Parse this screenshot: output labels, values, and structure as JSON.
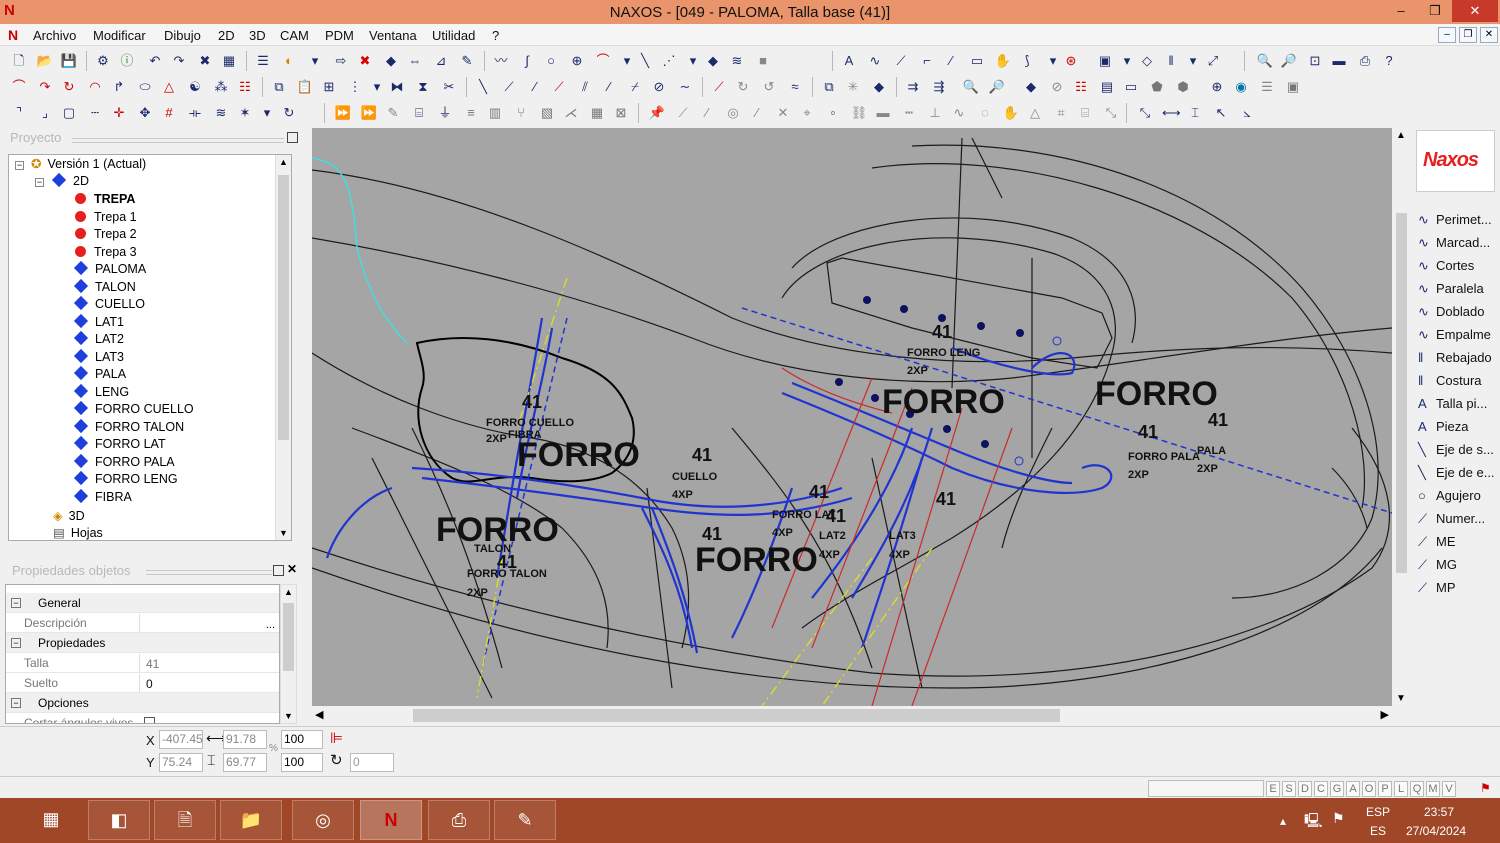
{
  "window": {
    "title": "NAXOS - [049 - PALOMA, Talla base (41)]",
    "min": "–",
    "max": "❐",
    "close": "✕"
  },
  "menu": [
    "Archivo",
    "Modificar",
    "Dibujo",
    "2D",
    "3D",
    "CAM",
    "PDM",
    "Ventana",
    "Utilidad",
    "?"
  ],
  "project": {
    "header": "Proyecto",
    "nodes": [
      {
        "label": "Versión 1 (Actual)",
        "type": "version"
      },
      {
        "label": "2D",
        "type": "folder"
      },
      {
        "label": "TREPA",
        "type": "red",
        "bold": true
      },
      {
        "label": "Trepa 1",
        "type": "red"
      },
      {
        "label": "Trepa 2",
        "type": "red"
      },
      {
        "label": "Trepa 3",
        "type": "red"
      },
      {
        "label": "PALOMA",
        "type": "piece"
      },
      {
        "label": "TALON",
        "type": "piece"
      },
      {
        "label": "CUELLO",
        "type": "piece"
      },
      {
        "label": "LAT1",
        "type": "piece"
      },
      {
        "label": "LAT2",
        "type": "piece"
      },
      {
        "label": "LAT3",
        "type": "piece"
      },
      {
        "label": "PALA",
        "type": "piece"
      },
      {
        "label": "LENG",
        "type": "piece"
      },
      {
        "label": "FORRO CUELLO",
        "type": "piece"
      },
      {
        "label": "FORRO TALON",
        "type": "piece"
      },
      {
        "label": "FORRO LAT",
        "type": "piece"
      },
      {
        "label": "FORRO PALA",
        "type": "piece"
      },
      {
        "label": "FORRO LENG",
        "type": "piece"
      },
      {
        "label": "FIBRA",
        "type": "piece"
      },
      {
        "label": "3D",
        "type": "folder3d"
      },
      {
        "label": "Hojas",
        "type": "sheets"
      }
    ]
  },
  "properties": {
    "header": "Propiedades objetos",
    "sec_general": "General",
    "descripcion_label": "Descripción",
    "descripcion_btn": "...",
    "sec_props": "Propiedades",
    "talla_label": "Talla",
    "talla": "41",
    "suelto_label": "Suelto",
    "suelto": "0",
    "sec_opciones": "Opciones",
    "cortar_label": "Cortar ángulos vivos"
  },
  "right_tools": [
    "Perimet...",
    "Marcad...",
    "Cortes",
    "Paralela",
    "Doblado",
    "Empalme",
    "Rebajado",
    "Costura",
    "Talla pi...",
    "Pieza",
    "Eje de s...",
    "Eje de e...",
    "Agujero",
    "Numer...",
    "ME",
    "MG",
    "MP"
  ],
  "right_logo": "Naxos",
  "coords": {
    "x_label": "X",
    "y_label": "Y",
    "x": "-407.45",
    "y": "75.24",
    "w": "91.78",
    "h": "69.77",
    "sx": "100",
    "sy": "100",
    "angle": "0",
    "pct": "%"
  },
  "status_flags": [
    "E",
    "S",
    "D",
    "C",
    "G",
    "A",
    "O",
    "P",
    "L",
    "Q",
    "M",
    "V"
  ],
  "tray": {
    "lang1": "ESP",
    "lang2": "ES",
    "time": "23:57",
    "date": "27/04/2024"
  },
  "canvas_labels": {
    "forro": "FORRO",
    "size": "41",
    "forro_leng": "FORRO LENG",
    "forro_cuello": "FORRO CUELLO",
    "fibra": "FIBRA",
    "cuello": "CUELLO",
    "talon": "TALON",
    "forro_talon": "FORRO TALON",
    "forro_lat": "FORRO LAT",
    "lat2": "LAT2",
    "lat3": "LAT3",
    "forro_pala": "FORRO PALA",
    "pala": "PALA",
    "qty2": "2XP",
    "qty4": "4XP"
  },
  "colors": {
    "canvas_bg": "#a5a5a5",
    "titlebar": "#e9946a",
    "taskbar": "#a04728",
    "piece_blue": "#1f3fdc",
    "trepa_red": "#e61f1f"
  }
}
